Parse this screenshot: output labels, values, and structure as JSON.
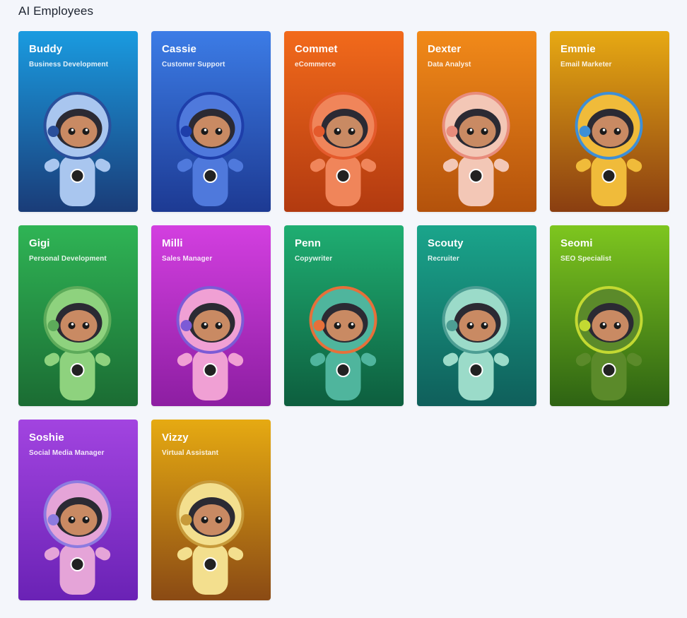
{
  "page": {
    "title": "AI Employees"
  },
  "employees": [
    {
      "name": "Buddy",
      "role": "Business Development",
      "top": "#1a9be0",
      "bottom": "#1a3c78",
      "suit": "#a9c6ef",
      "accent": "#2a4f9b"
    },
    {
      "name": "Cassie",
      "role": "Customer Support",
      "top": "#3c7ce6",
      "bottom": "#1d3a93",
      "suit": "#4f79dc",
      "accent": "#1e3eaa"
    },
    {
      "name": "Commet",
      "role": "eCommerce",
      "top": "#f26a1b",
      "bottom": "#b23a10",
      "suit": "#f0855a",
      "accent": "#e45a2c"
    },
    {
      "name": "Dexter",
      "role": "Data Analyst",
      "top": "#f28a19",
      "bottom": "#b3520c",
      "suit": "#f3c7b6",
      "accent": "#e88c7c"
    },
    {
      "name": "Emmie",
      "role": "Email Marketer",
      "top": "#e7a913",
      "bottom": "#8a3e11",
      "suit": "#f0bb3a",
      "accent": "#3e8fd6"
    },
    {
      "name": "Gigi",
      "role": "Personal Development",
      "top": "#2fb455",
      "bottom": "#1b6c33",
      "suit": "#8ed27e",
      "accent": "#5dab5a"
    },
    {
      "name": "Milli",
      "role": "Sales Manager",
      "top": "#d33fe0",
      "bottom": "#8d1ea2",
      "suit": "#f0a0d4",
      "accent": "#7c5bd6"
    },
    {
      "name": "Penn",
      "role": "Copywriter",
      "top": "#1fae72",
      "bottom": "#0d5e3e",
      "suit": "#4fb59d",
      "accent": "#e6703a"
    },
    {
      "name": "Scouty",
      "role": "Recruiter",
      "top": "#1aa58b",
      "bottom": "#0f5f5b",
      "suit": "#9bdbc9",
      "accent": "#4d9e94"
    },
    {
      "name": "Seomi",
      "role": "SEO Specialist",
      "top": "#7ec61f",
      "bottom": "#2e6313",
      "suit": "#5b8a2a",
      "accent": "#c3d932"
    },
    {
      "name": "Soshie",
      "role": "Social Media Manager",
      "top": "#a244e0",
      "bottom": "#6a22b5",
      "suit": "#e5a4d8",
      "accent": "#8c7be0"
    },
    {
      "name": "Vizzy",
      "role": "Virtual Assistant",
      "top": "#e6aa12",
      "bottom": "#8a4a14",
      "suit": "#f3df8e",
      "accent": "#c79a3a"
    }
  ]
}
